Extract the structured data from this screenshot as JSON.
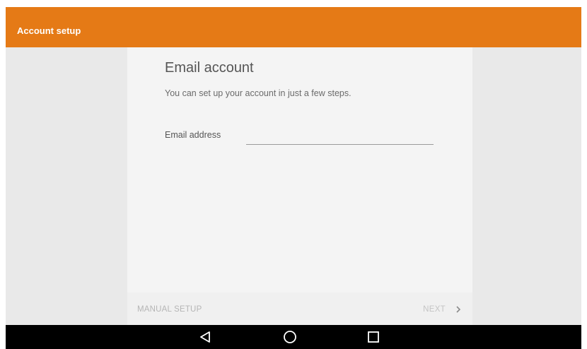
{
  "app_bar": {
    "title": "Account setup",
    "color": "#e57a16"
  },
  "card": {
    "title": "Email account",
    "subtitle": "You can set up your account in just a few steps.",
    "email_field": {
      "label": "Email address",
      "value": "",
      "placeholder": ""
    },
    "footer": {
      "manual_setup_label": "MANUAL SETUP",
      "next_label": "NEXT",
      "next_icon": "chevron-right-icon"
    }
  },
  "nav_bar": {
    "buttons": [
      {
        "icon": "back-triangle-icon"
      },
      {
        "icon": "home-circle-icon"
      },
      {
        "icon": "recents-square-icon"
      }
    ]
  }
}
